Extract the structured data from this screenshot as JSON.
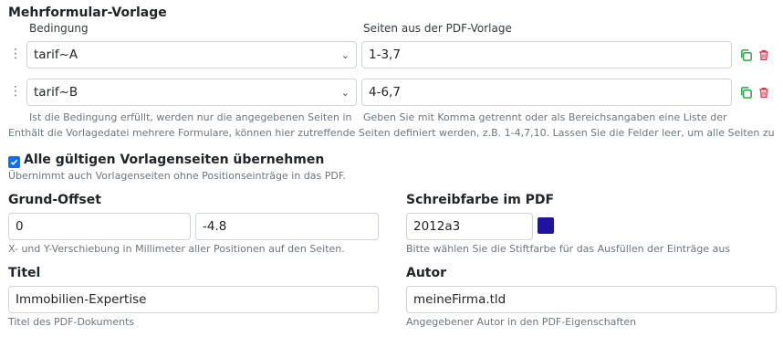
{
  "multi_form": {
    "title": "Mehrformular-Vorlage",
    "col_condition": "Bedingung",
    "col_pages": "Seiten aus der PDF-Vorlage",
    "rows": [
      {
        "condition": "tarif~A",
        "pages": "1-3,7"
      },
      {
        "condition": "tarif~B",
        "pages": "4-6,7"
      }
    ],
    "help_condition": "Ist die Bedingung erfüllt, werden nur die angegebenen Seiten in",
    "help_pages": "Geben Sie mit Komma getrennt oder als Bereichsangaben eine Liste der",
    "help_full": "Enthält die Vorlagedatei mehrere Formulare, können hier zutreffende Seiten definiert werden, z.B. 1-4,7,10. Lassen Sie die Felder leer, um alle Seiten zu",
    "icons": {
      "drag": "drag-handle-icon",
      "copy": "copy-icon",
      "delete": "trash-icon"
    },
    "colors": {
      "copy": "#28a745",
      "delete": "#dc3545"
    }
  },
  "all_pages": {
    "checked": true,
    "label": "Alle gültigen Vorlagenseiten übernehmen",
    "help": "Übernimmt auch Vorlagenseiten ohne Positionseinträge in das PDF."
  },
  "offset": {
    "label": "Grund-Offset",
    "x": "0",
    "y": "-4.8",
    "help": "X- und Y-Verschiebung in Millimeter aller Positionen auf den Seiten."
  },
  "pen_color": {
    "label": "Schreibfarbe im PDF",
    "value": "2012a3",
    "swatch": "#2012a3",
    "help": "Bitte wählen Sie die Stiftfarbe für das Ausfüllen der Einträge aus"
  },
  "title_field": {
    "label": "Titel",
    "value": "Immobilien-Expertise",
    "help": "Titel des PDF-Dokuments"
  },
  "author_field": {
    "label": "Autor",
    "value": "meineFirma.tld",
    "help": "Angegebener Autor in den PDF-Eigenschaften"
  }
}
